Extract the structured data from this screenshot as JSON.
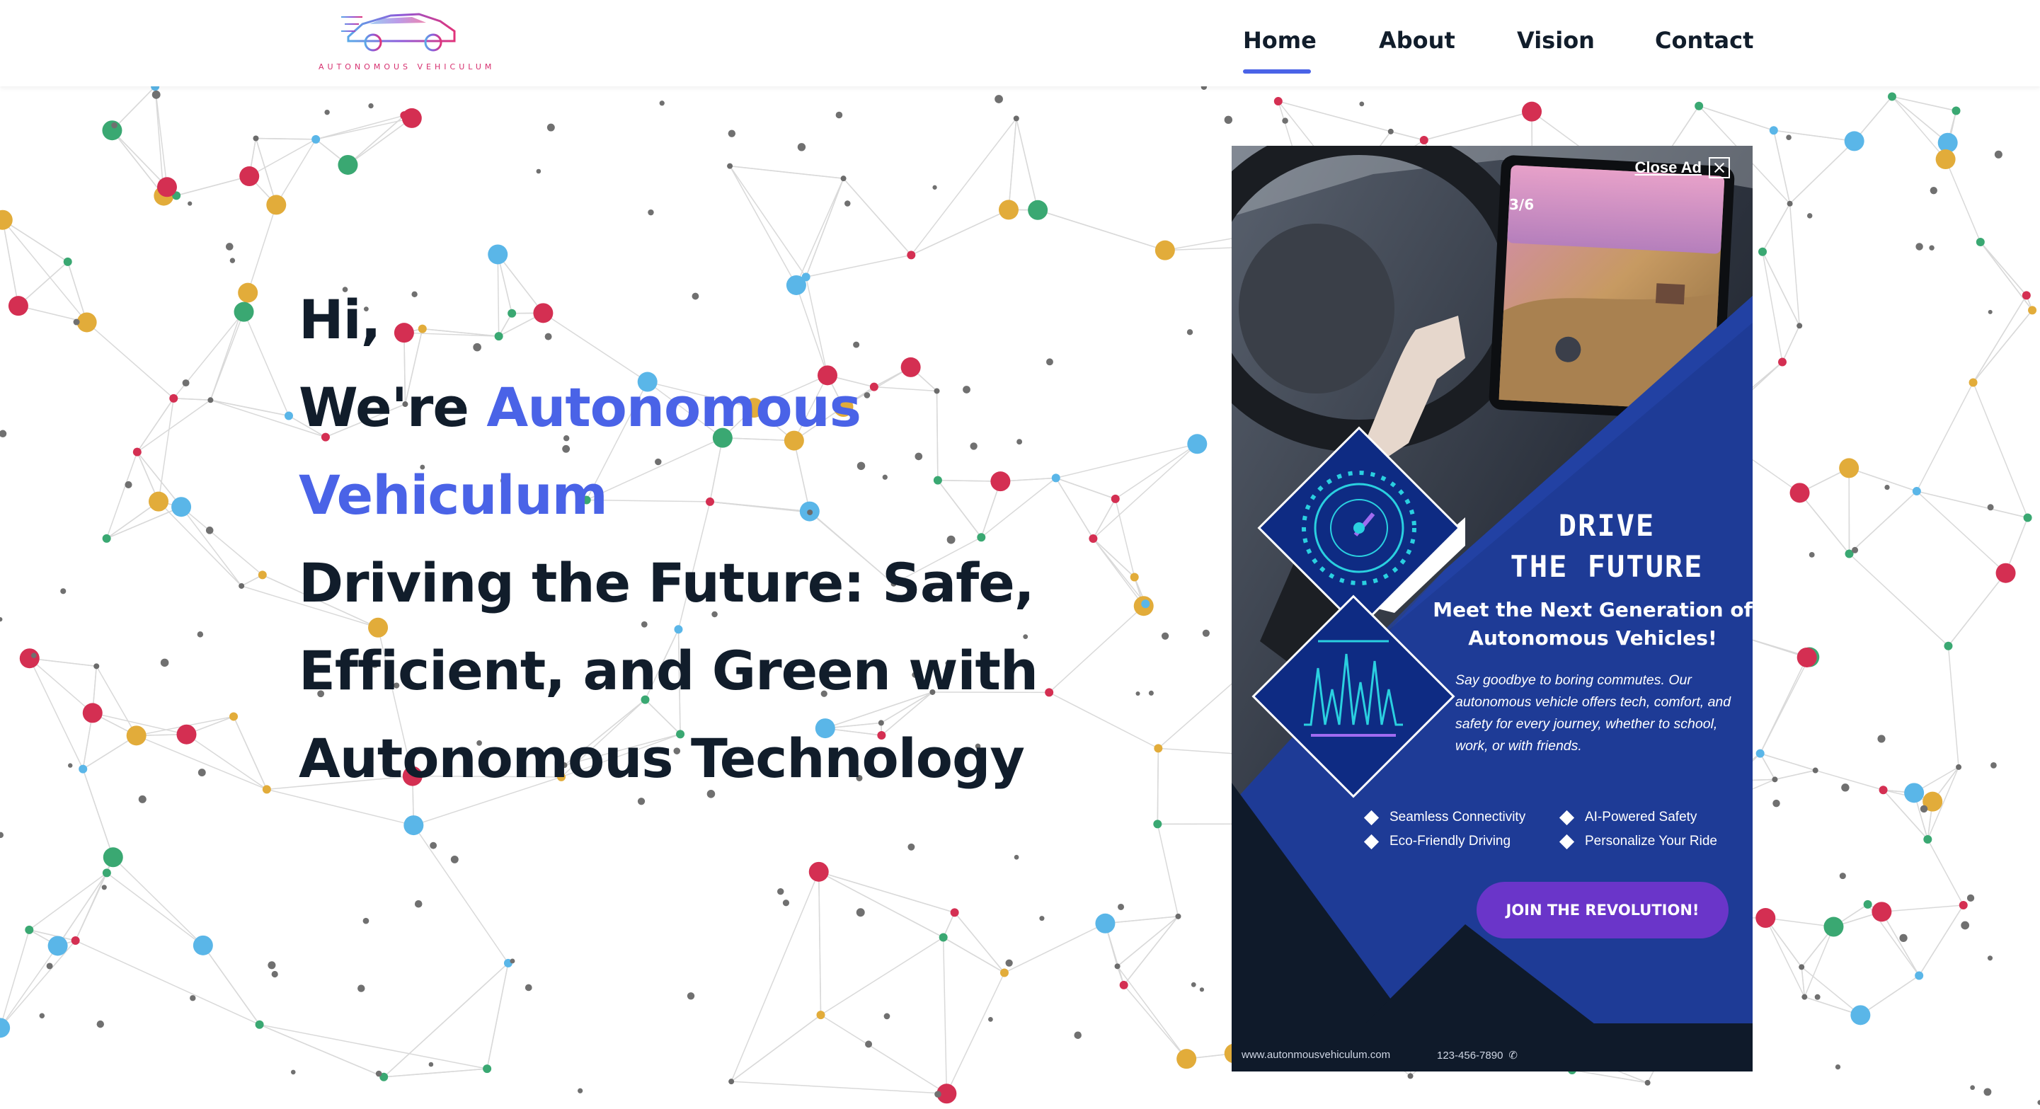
{
  "brand": {
    "name": "AUTONOMOUS VEHICULUM",
    "colors": {
      "accent": "#4a63e7",
      "logo_text": "#d6306f",
      "ink": "#111d2b"
    }
  },
  "nav": {
    "items": [
      {
        "label": "Home",
        "active": true
      },
      {
        "label": "About",
        "active": false
      },
      {
        "label": "Vision",
        "active": false
      },
      {
        "label": "Contact",
        "active": false
      }
    ]
  },
  "hero": {
    "greeting": "Hi,",
    "intro_prefix": "We're ",
    "name_part1": "Autonomous",
    "name_part2": "Vehiculum",
    "tagline_line1": "Driving the Future: Safe,",
    "tagline_line2": "Efficient, and Green with",
    "tagline_line3": "Autonomous Technology"
  },
  "ad": {
    "close_label": "Close Ad",
    "close_icon": "close-x-icon",
    "screen_counter": "3/6",
    "headline_line1": "DRIVE",
    "headline_line2": "THE FUTURE",
    "subheadline": "Meet the Next Generation of Autonomous Vehicles!",
    "description": "Say goodbye to boring commutes. Our autonomous vehicle offers tech, comfort, and safety for every journey, whether to school, work, or with friends.",
    "features": [
      "Seamless Connectivity",
      "AI-Powered Safety",
      "Eco-Friendly Driving",
      "Personalize Your Ride"
    ],
    "cta_label": "JOIN THE REVOLUTION!",
    "website": "www.autonmousvehiculum.com",
    "phone": "123-456-7890",
    "colors": {
      "panel": "#1e3b96",
      "cta": "#6a35c9",
      "dark": "#0f1a2a"
    }
  },
  "background": {
    "pattern": "network-graph",
    "node_colors": [
      "#e2ac3a",
      "#5ab6e8",
      "#d42f52",
      "#3aa872",
      "#6b6b6b"
    ]
  }
}
